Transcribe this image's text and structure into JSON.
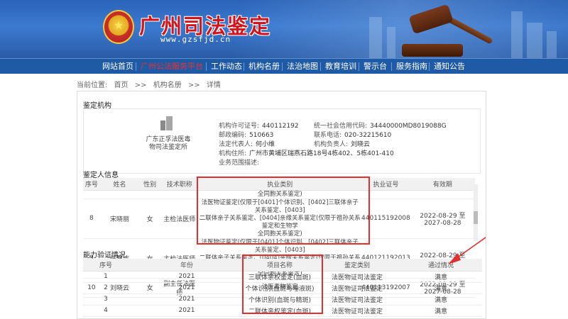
{
  "header": {
    "site_title": "广州司法鉴定",
    "site_url": "www.gzsfjd.cn"
  },
  "nav": {
    "items": [
      {
        "label": "网站首页",
        "active": false
      },
      {
        "label": "广州公法服务平台",
        "active": true
      },
      {
        "label": "工作动态",
        "active": false
      },
      {
        "label": "机构名册",
        "active": false
      },
      {
        "label": "法治地图",
        "active": false
      },
      {
        "label": "教育培训",
        "active": false
      },
      {
        "label": "警示台",
        "active": false
      },
      {
        "label": "服务指南",
        "active": false
      },
      {
        "label": "通知公告",
        "active": false
      }
    ]
  },
  "breadcrumb": {
    "prefix": "当前位置:",
    "items": [
      "首页",
      ">>",
      "机构名册",
      ">>",
      "详情"
    ]
  },
  "org": {
    "section_title": "鉴定机构",
    "name": "广东正孚法医毒物司法鉴定所",
    "license_label": "机构许可证号:",
    "license_value": "440112192",
    "credit_label": "统一社会信用代码:",
    "credit_value": "34440000MD8019088G",
    "postcode_label": "邮政编码:",
    "postcode_value": "510663",
    "phone_label": "联系电话:",
    "phone_value": "020-32215610",
    "legal_rep_label": "法定代表人:",
    "legal_rep_value": "何小维",
    "manager_label": "机构负责人:",
    "manager_value": "刘晓云",
    "address_label": "机构住所:",
    "address_value": "广州市黄埔区瑞燕石路18号4栋402、5栋401-410",
    "scope_label": "业务范围描述:",
    "scope_value": ""
  },
  "appraisers": {
    "section_title": "鉴定人信息",
    "columns": [
      "序号",
      "姓名",
      "性别",
      "技术职称",
      "执业类别",
      "执业证号",
      "有效期"
    ],
    "partial_top_category": "全同胞关系鉴定)",
    "rows": [
      {
        "no": "8",
        "name": "宋晓丽",
        "gender": "女",
        "title": "主检法医师",
        "category_lines": [
          "法医物证鉴定(仅限于[0401]个体识别、[0402]三联体亲子关系鉴定、[0403]",
          "二联体亲子关系鉴定、[0404]亲缘关系鉴定(仅限于祖孙关系鉴定和生物学",
          "全同胞关系鉴定)"
        ],
        "cert": "440115192008",
        "valid": "2022-08-29 至 2027-08-28"
      },
      {
        "no": "9",
        "name": "陆慧洁",
        "gender": "女",
        "title": "主检法医师",
        "category_lines": [
          "法医物证鉴定(仅限于[0401]个体识别、[0402]三联体亲子关系鉴定、[0403]",
          "二联体亲子关系鉴定、[0404]亲缘关系鉴定(仅限于祖孙关系鉴定和生物学",
          "全同胞关系鉴定)"
        ],
        "cert": "440121192013",
        "valid": "2022-08-29 至 2027-08-28"
      },
      {
        "no": "10",
        "name": "刘晓云",
        "gender": "女",
        "title": "副主任法医师",
        "category_lines": [
          "法医毒物鉴定"
        ],
        "cert": "440113192007",
        "valid": "2022-08-29 至 2027-08-28"
      }
    ]
  },
  "proficiency": {
    "section_title": "能力验证情况",
    "columns": [
      "序号",
      "年份",
      "项目名称",
      "鉴定类别",
      "通过情况"
    ],
    "rows": [
      {
        "no": "1",
        "year": "2021",
        "project": "三联体亲权鉴定(血斑)",
        "category": "法医物证司法鉴定",
        "result": "满意"
      },
      {
        "no": "2",
        "year": "2021",
        "project": "个体识别(血斑与唾液斑)",
        "category": "法医物证司法鉴定",
        "result": "满意"
      },
      {
        "no": "3",
        "year": "2021",
        "project": "个体识别(血斑与精斑)",
        "category": "法医物证司法鉴定",
        "result": "满意"
      },
      {
        "no": "4",
        "year": "2021",
        "project": "二联体亲权鉴定(血斑)",
        "category": "法医物证司法鉴定",
        "result": "满意"
      }
    ]
  },
  "colors": {
    "nav_bg": "#1f5aa6",
    "nav_active": "#f03030",
    "highlight": "#e03030"
  }
}
